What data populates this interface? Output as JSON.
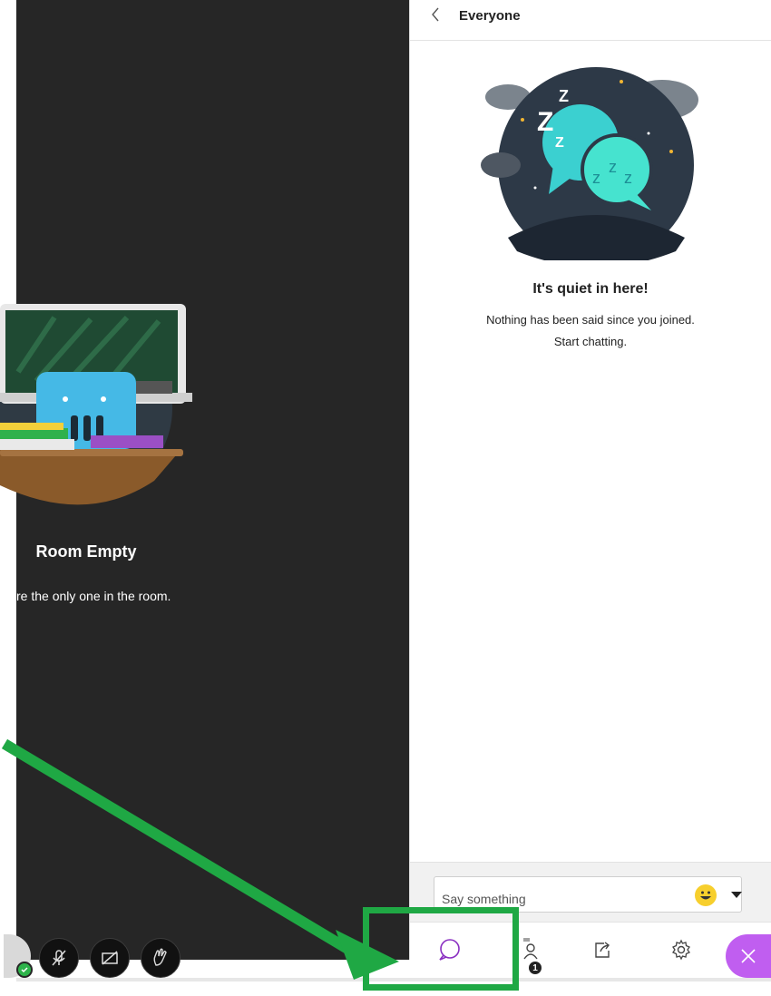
{
  "stage": {
    "room_title": "Room Empty",
    "room_subtitle": "re the only one in the room."
  },
  "chat_panel": {
    "title": "Everyone",
    "empty_title": "It's quiet in here!",
    "empty_line1": "Nothing has been said since you joined.",
    "empty_line2": "Start chatting.",
    "input_placeholder": "Say something",
    "participants_badge": "1"
  },
  "icons": {
    "back": "chevron-left-icon",
    "emoji": "emoji-icon",
    "mic": "microphone-off-icon",
    "camera": "camera-off-icon",
    "hand": "raise-hand-icon",
    "chat": "chat-icon",
    "participants": "participants-icon",
    "share": "share-content-icon",
    "settings": "gear-icon",
    "leave": "close-icon"
  },
  "colors": {
    "stage_bg": "#262626",
    "accent_purple": "#8a2fc1",
    "leave_purple": "#c05ef0",
    "annotation_green": "#1fa844",
    "status_green": "#2db34a"
  }
}
